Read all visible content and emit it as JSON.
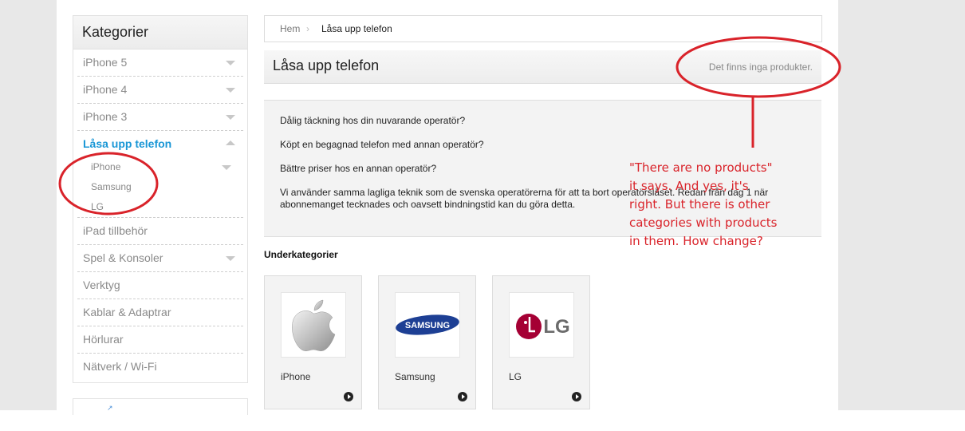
{
  "sidebar": {
    "heading": "Kategorier",
    "items": [
      {
        "label": "iPhone 5",
        "expandable": true
      },
      {
        "label": "iPhone 4",
        "expandable": true
      },
      {
        "label": "iPhone 3",
        "expandable": true
      },
      {
        "label": "Låsa upp telefon",
        "expandable": true,
        "active": true,
        "children": [
          {
            "label": "iPhone",
            "expandable": true
          },
          {
            "label": "Samsung"
          },
          {
            "label": "LG"
          }
        ]
      },
      {
        "label": "iPad tillbehör",
        "expandable": false
      },
      {
        "label": "Spel & Konsoler",
        "expandable": true
      },
      {
        "label": "Verktyg",
        "expandable": false
      },
      {
        "label": "Kablar & Adaptrar",
        "expandable": false
      },
      {
        "label": "Hörlurar",
        "expandable": false
      },
      {
        "label": "Nätverk / Wi-Fi",
        "expandable": false
      }
    ]
  },
  "breadcrumb": {
    "home": "Hem",
    "separator": "›",
    "current": "Låsa upp telefon"
  },
  "page": {
    "title": "Låsa upp telefon",
    "no_products": "Det finns inga produkter."
  },
  "description": {
    "lines": [
      "Dålig täckning hos din nuvarande operatör?",
      "Köpt en begagnad telefon med annan operatör?",
      "Bättre priser hos en annan operatör?",
      "Vi använder samma lagliga teknik som de svenska operatörerna för att ta bort operatörslåset. Redan från dag 1 när abonnemanget tecknades och oavsett bindningstid kan du göra detta."
    ]
  },
  "subcategories": {
    "heading": "Underkategorier",
    "cards": [
      {
        "label": "iPhone",
        "icon": "apple-logo"
      },
      {
        "label": "Samsung",
        "icon": "samsung-logo",
        "logo_text": "SAMSUNG"
      },
      {
        "label": "LG",
        "icon": "lg-logo",
        "logo_text": "LG"
      }
    ]
  },
  "annotation": {
    "text": "\"There are no products\" it says. And yes, it's right. But there is other categories with products in them. How change?",
    "color": "#d9232a"
  },
  "colors": {
    "accent": "#1a97d6",
    "annotation": "#d9232a",
    "samsung_blue": "#1d3f94",
    "lg_red": "#a50034"
  }
}
